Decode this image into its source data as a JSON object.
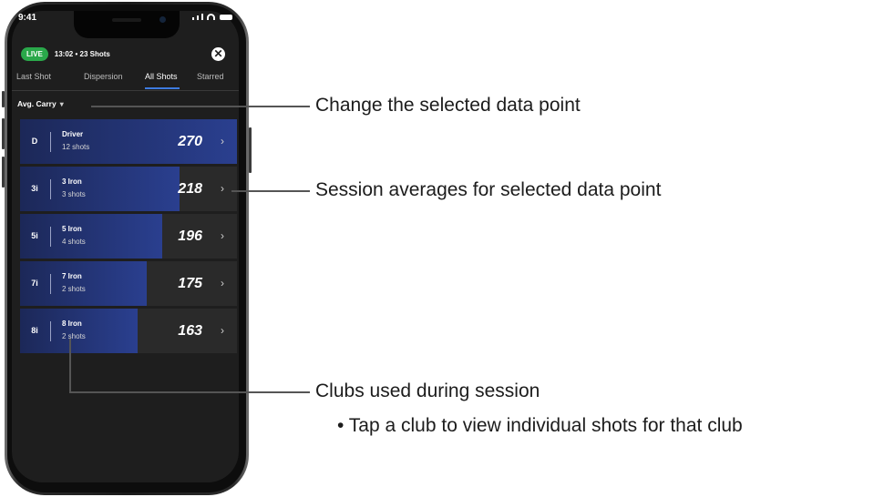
{
  "status_bar": {
    "time": "9:41"
  },
  "session": {
    "live_label": "LIVE",
    "info": "13:02 • 23 Shots",
    "close_icon": "close-icon"
  },
  "tabs": [
    {
      "label": "Last Shot",
      "active": false
    },
    {
      "label": "Dispersion",
      "active": false
    },
    {
      "label": "All Shots",
      "active": true
    },
    {
      "label": "Starred",
      "active": false
    }
  ],
  "metric_selector": {
    "label": "Avg. Carry",
    "icon": "chevron-down-icon"
  },
  "clubs": [
    {
      "abbr": "D",
      "name": "Driver",
      "shots": "12 shots",
      "value": "270",
      "bar_fraction": 1.0
    },
    {
      "abbr": "3i",
      "name": "3 Iron",
      "shots": "3 shots",
      "value": "218",
      "bar_fraction": 0.736
    },
    {
      "abbr": "5i",
      "name": "5 Iron",
      "shots": "4 shots",
      "value": "196",
      "bar_fraction": 0.657
    },
    {
      "abbr": "7i",
      "name": "7 Iron",
      "shots": "2 shots",
      "value": "175",
      "bar_fraction": 0.582
    },
    {
      "abbr": "8i",
      "name": "8 Iron",
      "shots": "2 shots",
      "value": "163",
      "bar_fraction": 0.54
    }
  ],
  "annotations": {
    "metric": "Change the selected data point",
    "averages": "Session averages for selected data point",
    "clubs": "Clubs used during session",
    "clubs_bullet": "• Tap a club to view individual shots for that club"
  },
  "colors": {
    "live": "#2aa84a",
    "bar": "#2a3f8f",
    "tab_underline": "#3d7be0",
    "background": "#1e1e1e"
  }
}
